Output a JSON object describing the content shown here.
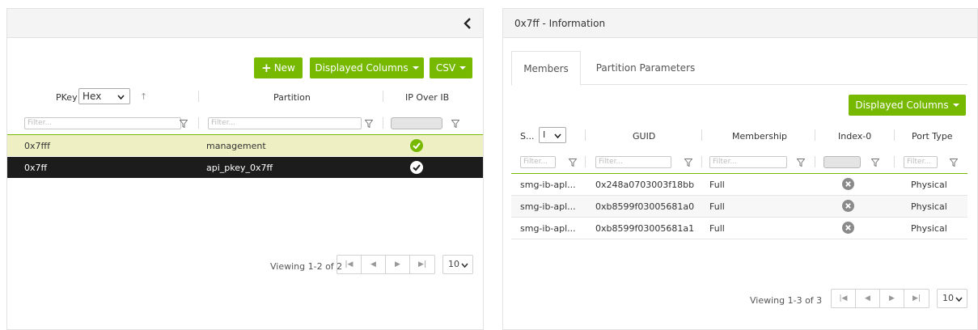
{
  "left_panel": {
    "collapse_icon": "chevron-left-icon",
    "new_label": "New",
    "displayed_columns_label": "Displayed Columns",
    "csv_label": "CSV",
    "columns": {
      "pkey": "PKey",
      "pkey_format": "Hex",
      "partition": "Partition",
      "ip_over_ib": "IP Over IB"
    },
    "filter_placeholder": "Filter...",
    "rows": [
      {
        "pkey": "0x7fff",
        "partition": "management",
        "ip_over_ib": true,
        "state": "highlighted"
      },
      {
        "pkey": "0x7ff",
        "partition": "api_pkey_0x7ff",
        "ip_over_ib": true,
        "state": "selected"
      }
    ],
    "pager": {
      "viewing": "Viewing 1-2 of 2",
      "page_size": "10"
    }
  },
  "right_panel": {
    "title": "0x7ff - Information",
    "tabs": [
      {
        "label": "Members",
        "active": true
      },
      {
        "label": "Partition Parameters",
        "active": false
      }
    ],
    "displayed_columns_label": "Displayed Columns",
    "columns": {
      "system": "S...",
      "system_select": "I",
      "guid": "GUID",
      "membership": "Membership",
      "index0": "Index-0",
      "port_type": "Port Type"
    },
    "filter_placeholder": "Filter...",
    "rows": [
      {
        "system": "smg-ib-apl...",
        "guid": "0x248a0703003f18bb",
        "membership": "Full",
        "index0": false,
        "port_type": "Physical"
      },
      {
        "system": "smg-ib-apl...",
        "guid": "0xb8599f03005681a0",
        "membership": "Full",
        "index0": false,
        "port_type": "Physical"
      },
      {
        "system": "smg-ib-apl...",
        "guid": "0xb8599f03005681a1",
        "membership": "Full",
        "index0": false,
        "port_type": "Physical"
      }
    ],
    "pager": {
      "viewing": "Viewing 1-3 of 3",
      "page_size": "10"
    }
  },
  "colors": {
    "accent": "#76b900",
    "highlight_row": "#eef0c4",
    "selected_row": "#1c1c1c"
  }
}
